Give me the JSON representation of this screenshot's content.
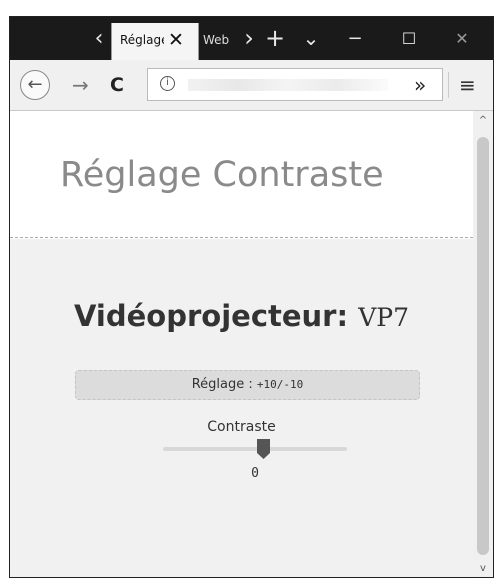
{
  "browser": {
    "tabs": [
      {
        "label": "Réglage Contraste",
        "active": true
      },
      {
        "label": "Web"
      }
    ],
    "url_visible": ""
  },
  "icons": {
    "tab_scroll_left": "‹",
    "tab_close": "✕",
    "tab_scroll_right": "›",
    "new_tab": "+",
    "tab_list": "⌄",
    "minimize": "−",
    "maximize": "☐",
    "close": "✕",
    "back": "←",
    "forward": "→",
    "reload": "C",
    "info": "i",
    "overflow": "»",
    "menu": "≡",
    "scroll_up": "^",
    "scroll_down": "v"
  },
  "page": {
    "title": "Réglage Contraste",
    "device_prefix": "Vidéoprojecteur:",
    "device_code": "VP7",
    "range_label": "Réglage :",
    "range_values": "+10/-10",
    "slider_label": "Contraste",
    "slider_value": "0",
    "slider_fraction": 0.5
  },
  "colors": {
    "tab_strip": "#1a1a1a",
    "title": "#8a8a8a",
    "content_bg": "#f1f1f1",
    "thumb": "#555555"
  }
}
